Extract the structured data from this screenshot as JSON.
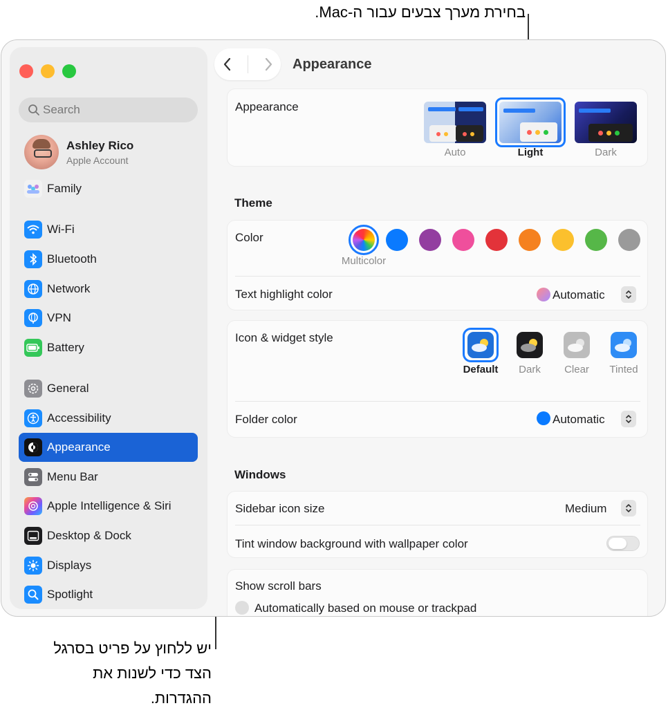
{
  "callouts": {
    "top": "בחירת מערך צבעים עבור ה‑Mac.",
    "bottom": "יש ללחוץ על פריט בסרגל הצד כדי לשנות את ההגדרות."
  },
  "search": {
    "placeholder": "Search"
  },
  "profile": {
    "name": "Ashley Rico",
    "subtitle": "Apple Account"
  },
  "sidebar": {
    "family": "Family",
    "items": [
      {
        "label": "Wi-Fi"
      },
      {
        "label": "Bluetooth"
      },
      {
        "label": "Network"
      },
      {
        "label": "VPN"
      },
      {
        "label": "Battery"
      },
      {
        "label": "General"
      },
      {
        "label": "Accessibility"
      },
      {
        "label": "Appearance"
      },
      {
        "label": "Menu Bar"
      },
      {
        "label": "Apple Intelligence & Siri"
      },
      {
        "label": "Desktop & Dock"
      },
      {
        "label": "Displays"
      },
      {
        "label": "Spotlight"
      }
    ]
  },
  "header": {
    "title": "Appearance"
  },
  "appearance": {
    "label": "Appearance",
    "options": [
      "Auto",
      "Light",
      "Dark"
    ],
    "selected": "Light"
  },
  "theme": {
    "title": "Theme",
    "color_label": "Color",
    "selected_color": "Multicolor",
    "colors": [
      "#0a7aff",
      "#933ea0",
      "#ef4f9c",
      "#e3333a",
      "#f5811f",
      "#fbc02d",
      "#56b748",
      "#9a9a9a"
    ],
    "text_highlight_label": "Text highlight color",
    "text_highlight_value": "Automatic"
  },
  "icon_widget": {
    "label": "Icon & widget style",
    "options": [
      "Default",
      "Dark",
      "Clear",
      "Tinted"
    ],
    "selected": "Default",
    "folder_label": "Folder color",
    "folder_value": "Automatic"
  },
  "windows": {
    "title": "Windows",
    "sidebar_icon_label": "Sidebar icon size",
    "sidebar_icon_value": "Medium",
    "tint_label": "Tint window background with wallpaper color",
    "tint_on": false
  },
  "scroll": {
    "label": "Show scroll bars",
    "option": "Automatically based on mouse or trackpad"
  },
  "colors": {
    "accent": "#1a63d6",
    "close": "#ff5f57",
    "minimize": "#febc2e",
    "zoom": "#28c840"
  }
}
